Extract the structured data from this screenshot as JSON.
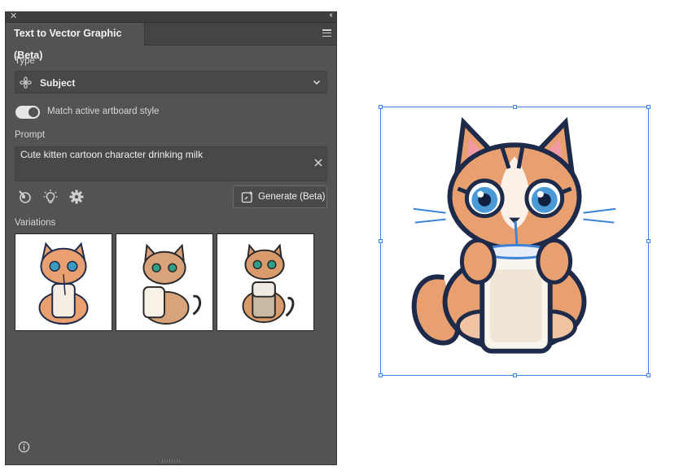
{
  "panel": {
    "tab_title": "Text to Vector Graphic (Beta)",
    "type_label": "Type",
    "type_value": "Subject",
    "match_style_label": "Match active artboard style",
    "match_style_on": true,
    "prompt_label": "Prompt",
    "prompt_value": "Cute kitten cartoon character drinking milk",
    "generate_label": "Generate (Beta)",
    "variations_label": "Variations"
  },
  "colors": {
    "panel_bg": "#535353",
    "selection_accent": "#3c82d6",
    "cat_orange": "#e8a070",
    "cat_outline": "#1d2a4a"
  },
  "icons": [
    "close-icon",
    "collapse-icon",
    "panel-menu-icon",
    "subject-icon",
    "chevron-down-icon",
    "clear-icon",
    "sample-icon",
    "bulb-icon",
    "gear-icon",
    "generate-icon",
    "info-icon"
  ]
}
